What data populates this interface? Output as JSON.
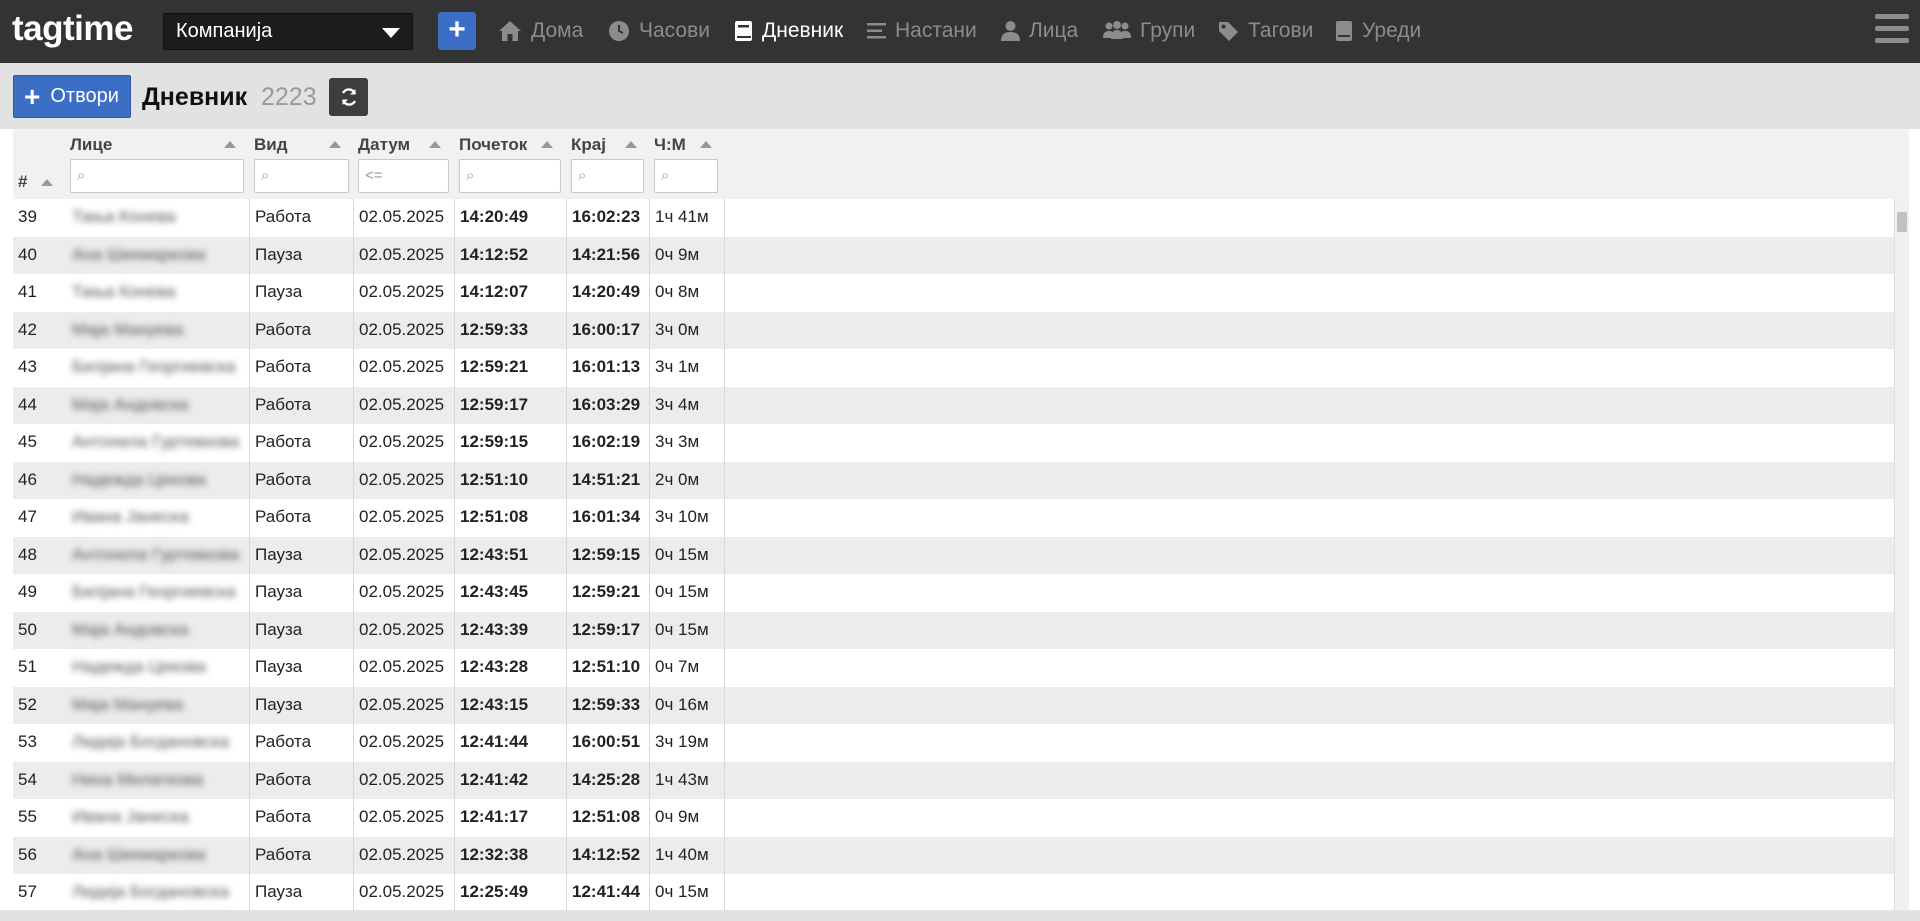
{
  "app": {
    "logo": "tagtime"
  },
  "navbar": {
    "company": "Компанија",
    "add_label": "+",
    "items": [
      {
        "label": "Дома",
        "icon": "home-icon",
        "active": false
      },
      {
        "label": "Часови",
        "icon": "clock-icon",
        "active": false
      },
      {
        "label": "Дневник",
        "icon": "book-icon",
        "active": true
      },
      {
        "label": "Настани",
        "icon": "list-icon",
        "active": false
      },
      {
        "label": "Лица",
        "icon": "user-icon",
        "active": false
      },
      {
        "label": "Групи",
        "icon": "users-icon",
        "active": false
      },
      {
        "label": "Тагови",
        "icon": "tag-icon",
        "active": false
      },
      {
        "label": "Уреди",
        "icon": "device-icon",
        "active": false
      }
    ]
  },
  "toolbar": {
    "open_label": "Отвори",
    "title": "Дневник",
    "count": "2223"
  },
  "table": {
    "columns": {
      "num": "#",
      "person": "Лице",
      "type": "Вид",
      "date": "Датум",
      "start": "Почеток",
      "end": "Крај",
      "hm": "Ч:М"
    },
    "filters": {
      "person": "⌕",
      "type": "⌕",
      "date": "<=",
      "start": "⌕",
      "end": "⌕",
      "hm": "⌕"
    },
    "rows": [
      {
        "num": "39",
        "person": "Тања Конева",
        "type": "Работа",
        "date": "02.05.2025",
        "start": "14:20:49",
        "end": "16:02:23",
        "hm": "1ч 41м"
      },
      {
        "num": "40",
        "person": "Ана Шкемаркова",
        "type": "Пауза",
        "date": "02.05.2025",
        "start": "14:12:52",
        "end": "14:21:56",
        "hm": "0ч 9м"
      },
      {
        "num": "41",
        "person": "Тања Конева",
        "type": "Пауза",
        "date": "02.05.2025",
        "start": "14:12:07",
        "end": "14:20:49",
        "hm": "0ч 8м"
      },
      {
        "num": "42",
        "person": "Маја Мануевa",
        "type": "Работа",
        "date": "02.05.2025",
        "start": "12:59:33",
        "end": "16:00:17",
        "hm": "3ч 0м"
      },
      {
        "num": "43",
        "person": "Билјана Георгиевска",
        "type": "Работа",
        "date": "02.05.2025",
        "start": "12:59:21",
        "end": "16:01:13",
        "hm": "3ч 1м"
      },
      {
        "num": "44",
        "person": "Маја Андовска",
        "type": "Работа",
        "date": "02.05.2025",
        "start": "12:59:17",
        "end": "16:03:29",
        "hm": "3ч 4м"
      },
      {
        "num": "45",
        "person": "Антонела Гуртевкова",
        "type": "Работа",
        "date": "02.05.2025",
        "start": "12:59:15",
        "end": "16:02:19",
        "hm": "3ч 3м"
      },
      {
        "num": "46",
        "person": "Надежда Цекова",
        "type": "Работа",
        "date": "02.05.2025",
        "start": "12:51:10",
        "end": "14:51:21",
        "hm": "2ч 0м"
      },
      {
        "num": "47",
        "person": "Ивана Јанеска",
        "type": "Работа",
        "date": "02.05.2025",
        "start": "12:51:08",
        "end": "16:01:34",
        "hm": "3ч 10м"
      },
      {
        "num": "48",
        "person": "Антонела Гуртевкова",
        "type": "Пауза",
        "date": "02.05.2025",
        "start": "12:43:51",
        "end": "12:59:15",
        "hm": "0ч 15м"
      },
      {
        "num": "49",
        "person": "Билјана Георгиевска",
        "type": "Пауза",
        "date": "02.05.2025",
        "start": "12:43:45",
        "end": "12:59:21",
        "hm": "0ч 15м"
      },
      {
        "num": "50",
        "person": "Маја Андовска",
        "type": "Пауза",
        "date": "02.05.2025",
        "start": "12:43:39",
        "end": "12:59:17",
        "hm": "0ч 15м"
      },
      {
        "num": "51",
        "person": "Надежда Цекова",
        "type": "Пауза",
        "date": "02.05.2025",
        "start": "12:43:28",
        "end": "12:51:10",
        "hm": "0ч 7м"
      },
      {
        "num": "52",
        "person": "Маја Мануевa",
        "type": "Пауза",
        "date": "02.05.2025",
        "start": "12:43:15",
        "end": "12:59:33",
        "hm": "0ч 16м"
      },
      {
        "num": "53",
        "person": "Лидија Богдановска",
        "type": "Работа",
        "date": "02.05.2025",
        "start": "12:41:44",
        "end": "16:00:51",
        "hm": "3ч 19м"
      },
      {
        "num": "54",
        "person": "Нина Милаткова",
        "type": "Работа",
        "date": "02.05.2025",
        "start": "12:41:42",
        "end": "14:25:28",
        "hm": "1ч 43м"
      },
      {
        "num": "55",
        "person": "Ивана Јанеска",
        "type": "Работа",
        "date": "02.05.2025",
        "start": "12:41:17",
        "end": "12:51:08",
        "hm": "0ч 9м"
      },
      {
        "num": "56",
        "person": "Ана Шкемаркова",
        "type": "Работа",
        "date": "02.05.2025",
        "start": "12:32:38",
        "end": "14:12:52",
        "hm": "1ч 40м"
      },
      {
        "num": "57",
        "person": "Лидија Богдановска",
        "type": "Пауза",
        "date": "02.05.2025",
        "start": "12:25:49",
        "end": "12:41:44",
        "hm": "0ч 15м"
      }
    ]
  },
  "colors": {
    "navbar_bg": "#333333",
    "accent": "#3b6ec4",
    "toolbar_bg": "#e2e2e2",
    "row_alt": "#ececec"
  }
}
